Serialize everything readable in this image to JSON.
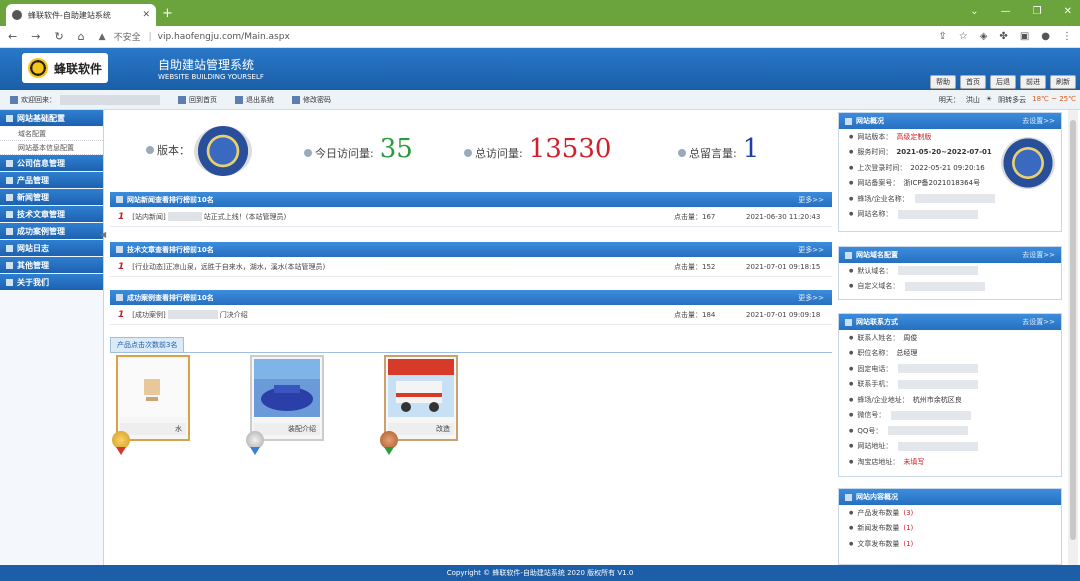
{
  "browser": {
    "tab_title": "蜂联软件-自助建站系统",
    "url_insecure": "不安全",
    "url": "vip.haofengju.com/Main.aspx"
  },
  "header": {
    "logo_text": "蜂联软件",
    "title": "自助建站管理系统",
    "subtitle": "WEBSITE BUILDING YOURSELF",
    "buttons": [
      "帮助",
      "首页",
      "后退",
      "前进",
      "刷新"
    ]
  },
  "infobar": {
    "welcome": "欢迎回来：",
    "back_home": "回到首页",
    "logout": "退出系统",
    "change_pwd": "修改密码",
    "weather_label": "明天：",
    "weather_city": "洪山",
    "weather_desc": "阴转多云",
    "weather_temp": "18℃ ~ 25℃"
  },
  "sidebar": {
    "sections": [
      {
        "label": "网站基础配置",
        "subs": [
          "域名配置",
          "网站基本信息配置"
        ]
      },
      {
        "label": "公司信息管理",
        "subs": []
      },
      {
        "label": "产品管理",
        "subs": []
      },
      {
        "label": "新闻管理",
        "subs": []
      },
      {
        "label": "技术文章管理",
        "subs": []
      },
      {
        "label": "成功案例管理",
        "subs": []
      },
      {
        "label": "网站日志",
        "subs": []
      },
      {
        "label": "其他管理",
        "subs": []
      },
      {
        "label": "关于我们",
        "subs": []
      }
    ]
  },
  "stats": {
    "version_label": "版本：",
    "today_label": "今日访问量:",
    "today_value": "35",
    "total_label": "总访问量:",
    "total_value": "13530",
    "messages_label": "总留言量:",
    "messages_value": "1"
  },
  "panels": [
    {
      "title": "网站新闻查看排行榜前10名",
      "more": "更多>>",
      "row": {
        "num": "1",
        "prefix": "[站内新闻]",
        "suffix": "站正式上线！(本站管理员)",
        "clicks": "点击量：167",
        "date": "2021-06-30 11:20:43"
      }
    },
    {
      "title": "技术文章查看排行榜前10名",
      "more": "更多>>",
      "row": {
        "num": "1",
        "prefix": "[行业动态]",
        "suffix": "正凉山泉，远胜于自来水，湖水，溪水(本站管理员)",
        "clicks": "点击量：152",
        "date": "2021-07-01 09:18:15"
      }
    },
    {
      "title": "成功案例查看排行榜前10名",
      "more": "更多>>",
      "row": {
        "num": "1",
        "prefix": "[成功案例]",
        "suffix": "门决介绍",
        "clicks": "点击量：184",
        "date": "2021-07-01 09:09:18"
      }
    }
  ],
  "products": {
    "tab": "产品点击次数前3名",
    "items": [
      {
        "caption": "水"
      },
      {
        "caption": "装配介绍"
      },
      {
        "caption": "改造"
      }
    ]
  },
  "right": {
    "overview": {
      "title": "网站概况",
      "set": "去设置>>",
      "items": [
        {
          "label": "网站版本：",
          "value": "高级定制版",
          "style": "red"
        },
        {
          "label": "服务时间：",
          "value": "2021-05-20~2022-07-01",
          "style": "bold"
        },
        {
          "label": "上次登录时间：",
          "value": "2022-05-21 09:20:16",
          "style": ""
        },
        {
          "label": "网站备案号：",
          "value": "浙ICP备2021018364号",
          "style": ""
        },
        {
          "label": "蜂场/企业名称：",
          "value": "",
          "style": "blur"
        },
        {
          "label": "网站名称：",
          "value": "",
          "style": "blur"
        }
      ]
    },
    "domain": {
      "title": "网站域名配置",
      "set": "去设置>>",
      "items": [
        {
          "label": "默认域名：",
          "value": "",
          "style": "blur"
        },
        {
          "label": "自定义域名：",
          "value": "",
          "style": "blur"
        }
      ]
    },
    "contact": {
      "title": "网站联系方式",
      "set": "去设置>>",
      "items": [
        {
          "label": "联系人姓名：",
          "value": "周俊",
          "style": ""
        },
        {
          "label": "职位名称：",
          "value": "总经理",
          "style": ""
        },
        {
          "label": "固定电话：",
          "value": "",
          "style": "blur"
        },
        {
          "label": "联系手机：",
          "value": "",
          "style": "blur"
        },
        {
          "label": "蜂场/企业地址：",
          "value": "杭州市余杭区良",
          "style": ""
        },
        {
          "label": "微信号：",
          "value": "",
          "style": "blur"
        },
        {
          "label": "QQ号：",
          "value": "",
          "style": "blur"
        },
        {
          "label": "网站地址：",
          "value": "",
          "style": "blur"
        },
        {
          "label": "淘宝店地址：",
          "value": "未填写",
          "style": "red"
        }
      ]
    },
    "content": {
      "title": "网站内容概况",
      "items": [
        {
          "label": "产品发布数量",
          "value": "(3)"
        },
        {
          "label": "新闻发布数量",
          "value": "(1)"
        },
        {
          "label": "文章发布数量",
          "value": "(1)"
        }
      ]
    }
  },
  "footer": "Copyright © 蜂联软件-自助建站系统 2020 版权所有 V1.0"
}
